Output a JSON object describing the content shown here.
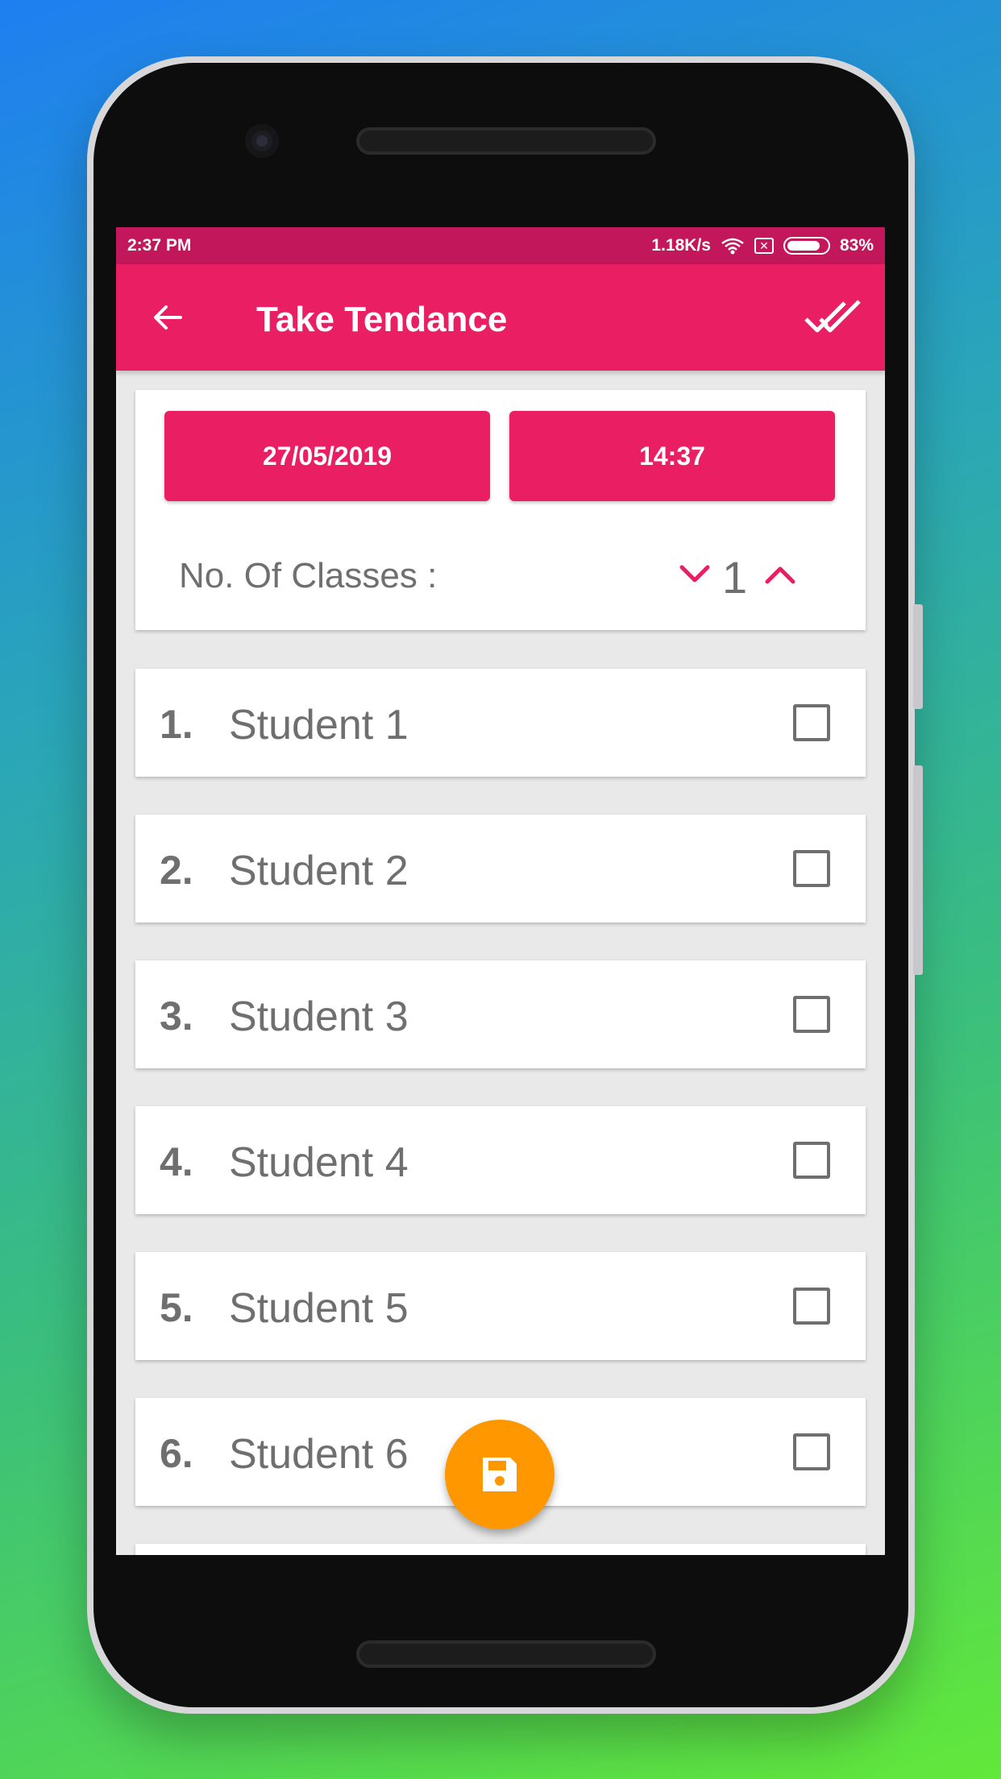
{
  "status_bar": {
    "time": "2:37 PM",
    "network_speed": "1.18K/s",
    "battery_percent": "83%",
    "battery_level": 0.83
  },
  "app_bar": {
    "title": "Take Tendance",
    "back_icon": "arrow-back-icon",
    "action_icon": "done-all-icon"
  },
  "session": {
    "date": "27/05/2019",
    "time": "14:37",
    "classes_label": "No. Of Classes :",
    "classes_value": "1"
  },
  "students": [
    {
      "num": "1.",
      "name": "Student 1",
      "checked": false
    },
    {
      "num": "2.",
      "name": "Student 2",
      "checked": false
    },
    {
      "num": "3.",
      "name": "Student 3",
      "checked": false
    },
    {
      "num": "4.",
      "name": "Student 4",
      "checked": false
    },
    {
      "num": "5.",
      "name": "Student 5",
      "checked": false
    },
    {
      "num": "6.",
      "name": "Student 6",
      "checked": false
    }
  ],
  "fab": {
    "icon": "save-icon"
  },
  "colors": {
    "primary": "#e91e63",
    "primary_dark": "#c2185b",
    "fab": "#ff9800",
    "text": "#6f6f6f"
  }
}
